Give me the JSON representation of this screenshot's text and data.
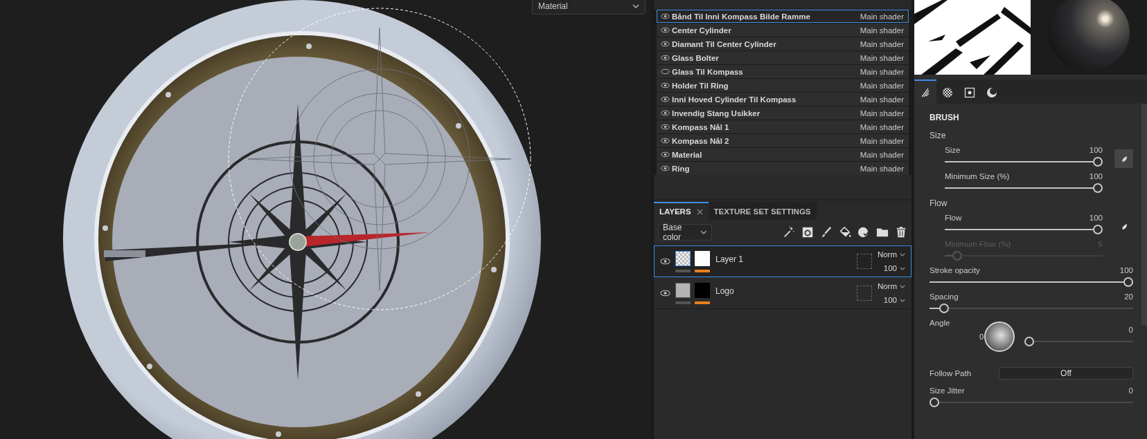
{
  "viewport": {
    "material_dropdown": {
      "value": "Material"
    }
  },
  "texture_sets": [
    {
      "name": "Bånd Til Inni Kompass Bilde Ramme",
      "shader": "Main shader",
      "visible": true,
      "selected": true
    },
    {
      "name": "Center Cylinder",
      "shader": "Main shader",
      "visible": true,
      "selected": false
    },
    {
      "name": "Diamant Til Center Cylinder",
      "shader": "Main shader",
      "visible": true,
      "selected": false
    },
    {
      "name": "Glass Bolter",
      "shader": "Main shader",
      "visible": true,
      "selected": false
    },
    {
      "name": "Glass Til Kompass",
      "shader": "Main shader",
      "visible": false,
      "selected": false
    },
    {
      "name": "Holder Til Ring",
      "shader": "Main shader",
      "visible": true,
      "selected": false
    },
    {
      "name": "Inni Hoved Cylinder Til Kompass",
      "shader": "Main shader",
      "visible": true,
      "selected": false
    },
    {
      "name": "Invendig Stang Usikker",
      "shader": "Main shader",
      "visible": true,
      "selected": false
    },
    {
      "name": "Kompass Nål 1",
      "shader": "Main shader",
      "visible": true,
      "selected": false
    },
    {
      "name": "Kompass Nål 2",
      "shader": "Main shader",
      "visible": true,
      "selected": false
    },
    {
      "name": "Material",
      "shader": "Main shader",
      "visible": true,
      "selected": false
    },
    {
      "name": "Ring",
      "shader": "Main shader",
      "visible": true,
      "selected": false
    }
  ],
  "layers_panel": {
    "tabs": [
      {
        "label": "LAYERS",
        "selected": true,
        "closable": true
      },
      {
        "label": "TEXTURE SET SETTINGS",
        "selected": false,
        "closable": false
      }
    ],
    "channel_dropdown": {
      "value": "Base color"
    },
    "layers": [
      {
        "name": "Layer 1",
        "kind": "paint",
        "blend": "Norm",
        "opacity": "100",
        "visible": true,
        "selected": true
      },
      {
        "name": "Logo",
        "kind": "fill",
        "blend": "Norm",
        "opacity": "100",
        "visible": true,
        "selected": false
      }
    ]
  },
  "properties": {
    "tabs": [
      {
        "selected": true
      },
      {
        "selected": false
      },
      {
        "selected": false
      },
      {
        "selected": false
      }
    ],
    "title": "BRUSH",
    "items": [
      {
        "kind": "group",
        "label": "Size",
        "children": [
          {
            "kind": "slider",
            "label": "Size",
            "value": "100",
            "level": 1,
            "pressure": {
              "selected": true
            }
          },
          {
            "kind": "slider",
            "label": "Minimum Size (%)",
            "value": "100",
            "level": 1
          }
        ]
      },
      {
        "kind": "group",
        "label": "Flow",
        "children": [
          {
            "kind": "slider",
            "label": "Flow",
            "value": "100",
            "level": 1,
            "pressure": {
              "selected": false
            }
          },
          {
            "kind": "slider",
            "label": "Minimum Flow (%)",
            "value": "5",
            "level": 0.05,
            "disabled": true
          }
        ]
      },
      {
        "kind": "slider",
        "label": "Stroke opacity",
        "value": "100",
        "level": 1
      },
      {
        "kind": "slider",
        "label": "Spacing",
        "value": "20",
        "level": 0.05
      },
      {
        "kind": "dial",
        "label": "Angle",
        "dial_label": "0",
        "value": "0",
        "level": 0
      },
      {
        "kind": "toggle",
        "label": "Follow Path",
        "value": "Off"
      },
      {
        "kind": "slider",
        "label": "Size Jitter",
        "value": "0",
        "level": 0
      }
    ]
  }
}
